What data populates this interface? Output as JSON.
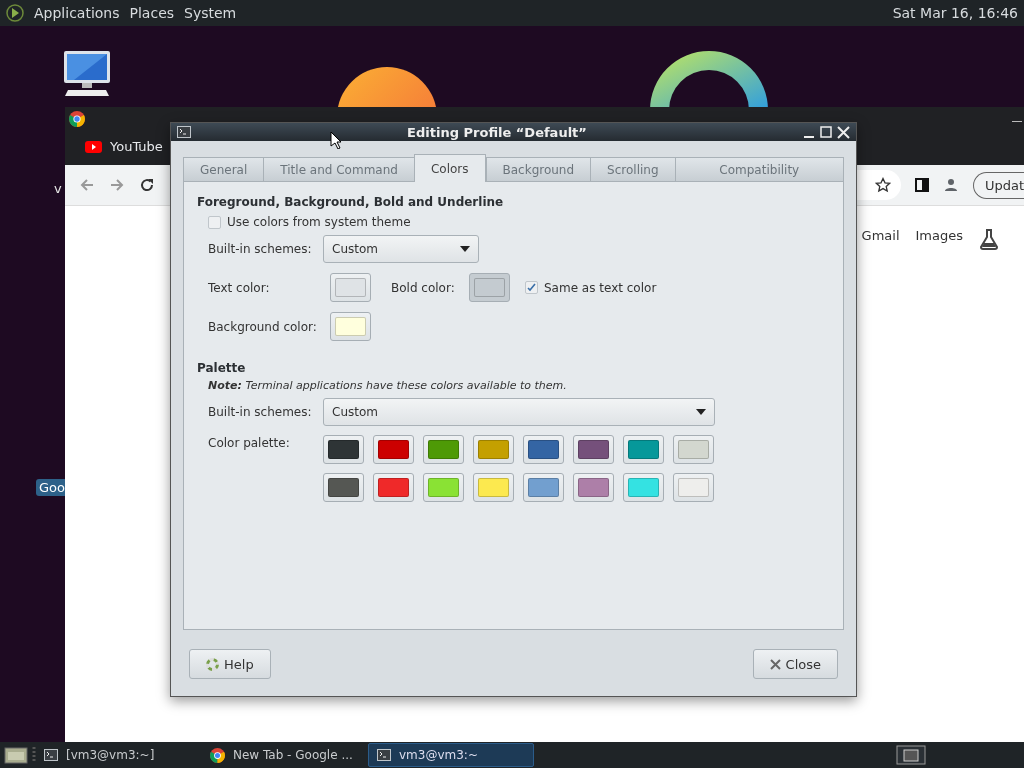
{
  "top_panel": {
    "menus": [
      "Applications",
      "Places",
      "System"
    ],
    "clock": "Sat Mar 16, 16:46"
  },
  "desktop": {
    "icons": [
      {
        "kind": "computer"
      },
      {
        "label": "v",
        "kind": "label"
      },
      {
        "label": "Goo",
        "kind": "highlighted_label"
      }
    ]
  },
  "browser": {
    "tabs": [
      {
        "label": "YouTube"
      }
    ],
    "update_button": "Updat",
    "links": [
      "Gmail",
      "Images"
    ]
  },
  "dialog": {
    "title": "Editing Profile “Default”",
    "tabs": [
      {
        "label": "General",
        "selected": false
      },
      {
        "label": "Title and Command",
        "selected": false
      },
      {
        "label": "Colors",
        "selected": true
      },
      {
        "label": "Background",
        "selected": false
      },
      {
        "label": "Scrolling",
        "selected": false
      },
      {
        "label": "Compatibility",
        "selected": false
      }
    ],
    "foreground": {
      "heading": "Foreground, Background, Bold and Underline",
      "use_system_colors": {
        "label": "Use colors from system theme",
        "checked": false
      },
      "schemes": {
        "label": "Built-in schemes:",
        "value": "Custom"
      },
      "text_color": {
        "label": "Text color:",
        "color": "#dfe3e6"
      },
      "bold_color": {
        "label": "Bold color:",
        "color": "#c4cbd0",
        "disabled": true
      },
      "same_as_text": {
        "label": "Same as text color",
        "checked": true
      },
      "background_color": {
        "label": "Background color:",
        "color": "#ffffdd"
      }
    },
    "palette": {
      "heading": "Palette",
      "note": "**Note:** Terminal applications have these colors available to them.",
      "schemes": {
        "label": "Built-in schemes:",
        "value": "Custom"
      },
      "palette_label": "Color palette:",
      "colors": [
        {
          "color": "#2e3436"
        },
        {
          "color": "#cc0000"
        },
        {
          "color": "#4e9a06"
        },
        {
          "color": "#c4a000"
        },
        {
          "color": "#3465a4"
        },
        {
          "color": "#75507b"
        },
        {
          "color": "#06989a"
        },
        {
          "color": "#d3d7cf"
        },
        {
          "color": "#555753"
        },
        {
          "color": "#ef2929"
        },
        {
          "color": "#8ae234"
        },
        {
          "color": "#fce94f"
        },
        {
          "color": "#729fcf"
        },
        {
          "color": "#ad7fa8"
        },
        {
          "color": "#34e2e2"
        },
        {
          "color": "#eeeeec"
        }
      ]
    },
    "buttons": [
      {
        "label": "Help",
        "kind": "help"
      },
      {
        "label": "Close",
        "kind": "close"
      }
    ]
  },
  "taskbar": {
    "items": [
      {
        "label": "[vm3@vm3:~]",
        "kind": "terminal",
        "selected": false
      },
      {
        "label": "New Tab - Google ...",
        "kind": "browser",
        "selected": false
      },
      {
        "label": "vm3@vm3:~",
        "kind": "terminal",
        "selected": true
      }
    ]
  }
}
